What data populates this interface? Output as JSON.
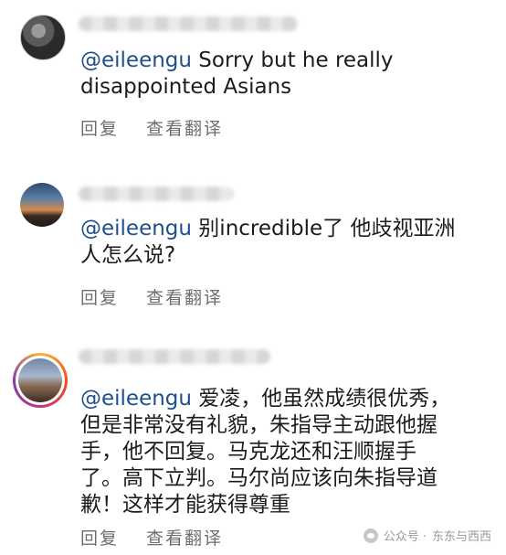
{
  "comments": [
    {
      "mention": "@eileengu",
      "text_lines": [
        " Sorry but he really",
        "disappointed Asians"
      ],
      "reply_label": "回复",
      "translate_label": "查看翻译"
    },
    {
      "mention": "@eileengu",
      "text_lines": [
        " 别incredible了 他歧视亚洲",
        "人怎么说?"
      ],
      "reply_label": "回复",
      "translate_label": "查看翻译"
    },
    {
      "mention": "@eileengu",
      "text_lines": [
        " 爱凌，他虽然成绩很优秀，",
        "但是非常没有礼貌，朱指导主动跟他握",
        "手，他不回复。马克龙还和汪顺握手",
        "了。高下立判。马尔尚应该向朱指导道",
        "歉！这样才能获得尊重"
      ],
      "reply_label": "回复",
      "translate_label": "查看翻译"
    }
  ],
  "watermark": {
    "prefix": "公众号 · ",
    "account": "东东与西西"
  }
}
